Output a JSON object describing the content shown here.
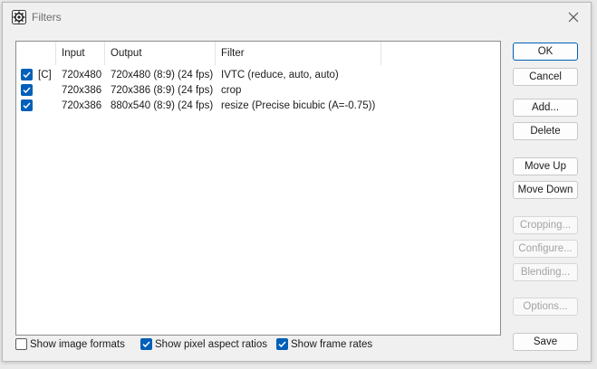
{
  "window": {
    "title": "Filters"
  },
  "table": {
    "headers": [
      "Input",
      "Output",
      "Filter"
    ],
    "rows": [
      {
        "checked": true,
        "marker": "[C]",
        "input": "720x480",
        "output": "720x480 (8:9) (24 fps)",
        "filter": "IVTC (reduce, auto, auto)"
      },
      {
        "checked": true,
        "marker": "",
        "input": "720x386",
        "output": "720x386 (8:9) (24 fps)",
        "filter": "crop"
      },
      {
        "checked": true,
        "marker": "",
        "input": "720x386",
        "output": "880x540 (8:9) (24 fps)",
        "filter": "resize (Precise bicubic (A=-0.75))"
      }
    ]
  },
  "buttons": {
    "ok": "OK",
    "cancel": "Cancel",
    "add": "Add...",
    "delete": "Delete",
    "move_up": "Move Up",
    "move_down": "Move Down",
    "cropping": "Cropping...",
    "configure": "Configure...",
    "blending": "Blending...",
    "options": "Options...",
    "save": "Save"
  },
  "options": {
    "show_image_formats": {
      "label": "Show image formats",
      "checked": false
    },
    "show_pixel_aspect_ratios": {
      "label": "Show pixel aspect ratios",
      "checked": true
    },
    "show_frame_rates": {
      "label": "Show frame rates",
      "checked": true
    }
  },
  "colors": {
    "accent": "#005fb8",
    "disabled_text": "#a3a3a3"
  },
  "icons": {
    "app": "gear-filter-icon",
    "close": "close-icon",
    "check": "checkmark-icon"
  }
}
